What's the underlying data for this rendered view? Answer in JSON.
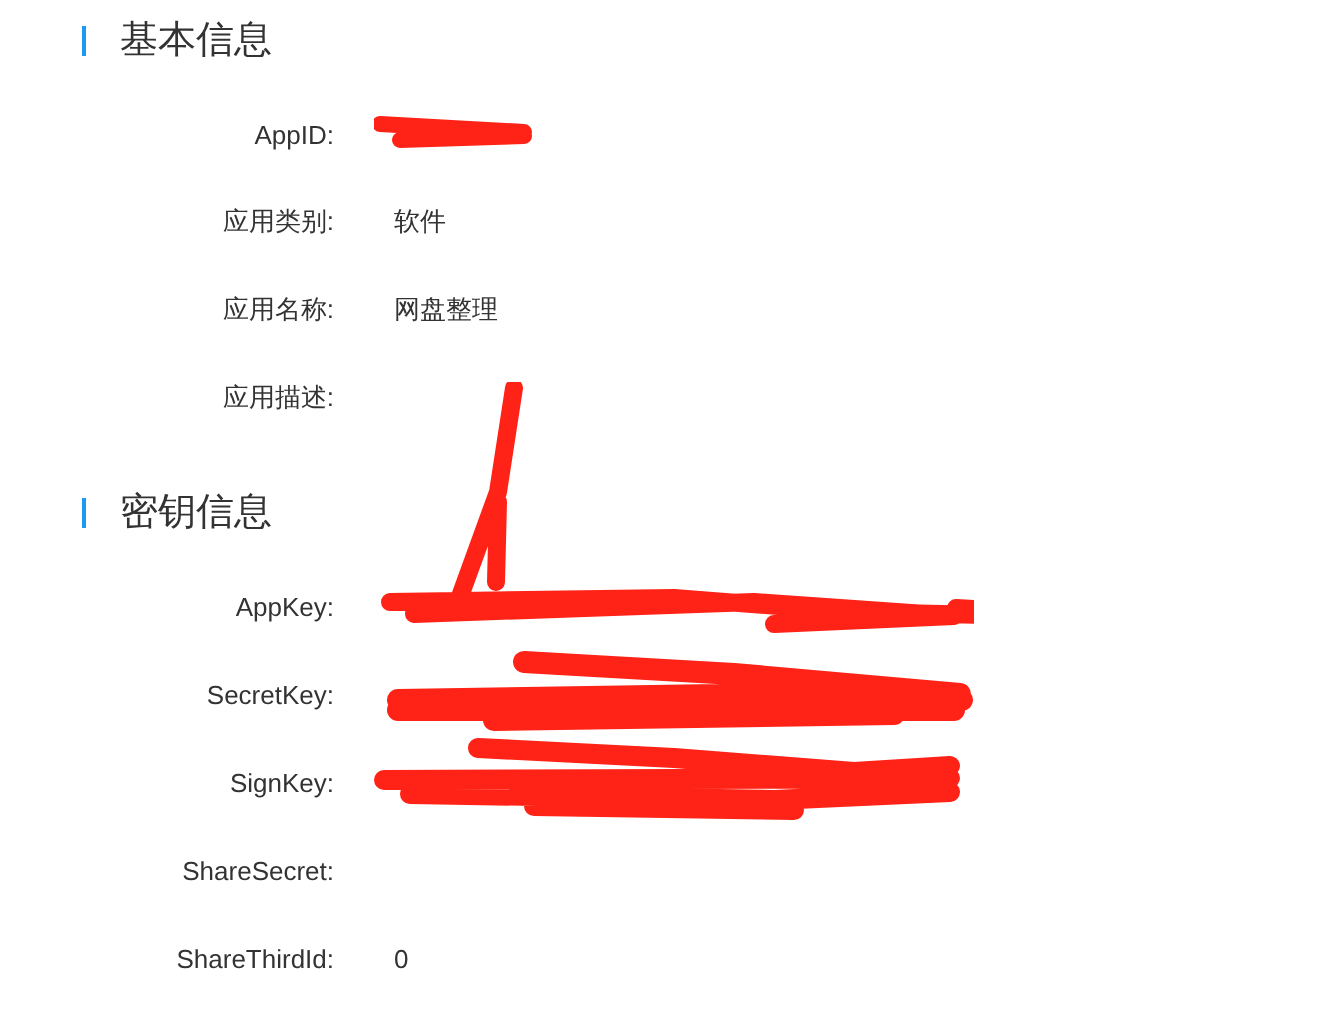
{
  "sections": [
    {
      "title": "基本信息",
      "fields": [
        {
          "label": "AppID:",
          "redacted": true
        },
        {
          "label": "应用类别:",
          "value": "软件"
        },
        {
          "label": "应用名称:",
          "value": "网盘整理"
        },
        {
          "label": "应用描述:"
        }
      ]
    },
    {
      "title": "密钥信息",
      "fields": [
        {
          "label": "AppKey:",
          "redacted": true
        },
        {
          "label": "SecretKey:",
          "redacted": true
        },
        {
          "label": "SignKey:",
          "redacted": true
        },
        {
          "label": "ShareSecret:"
        },
        {
          "label": "ShareThirdId:",
          "value": "0"
        }
      ]
    }
  ]
}
